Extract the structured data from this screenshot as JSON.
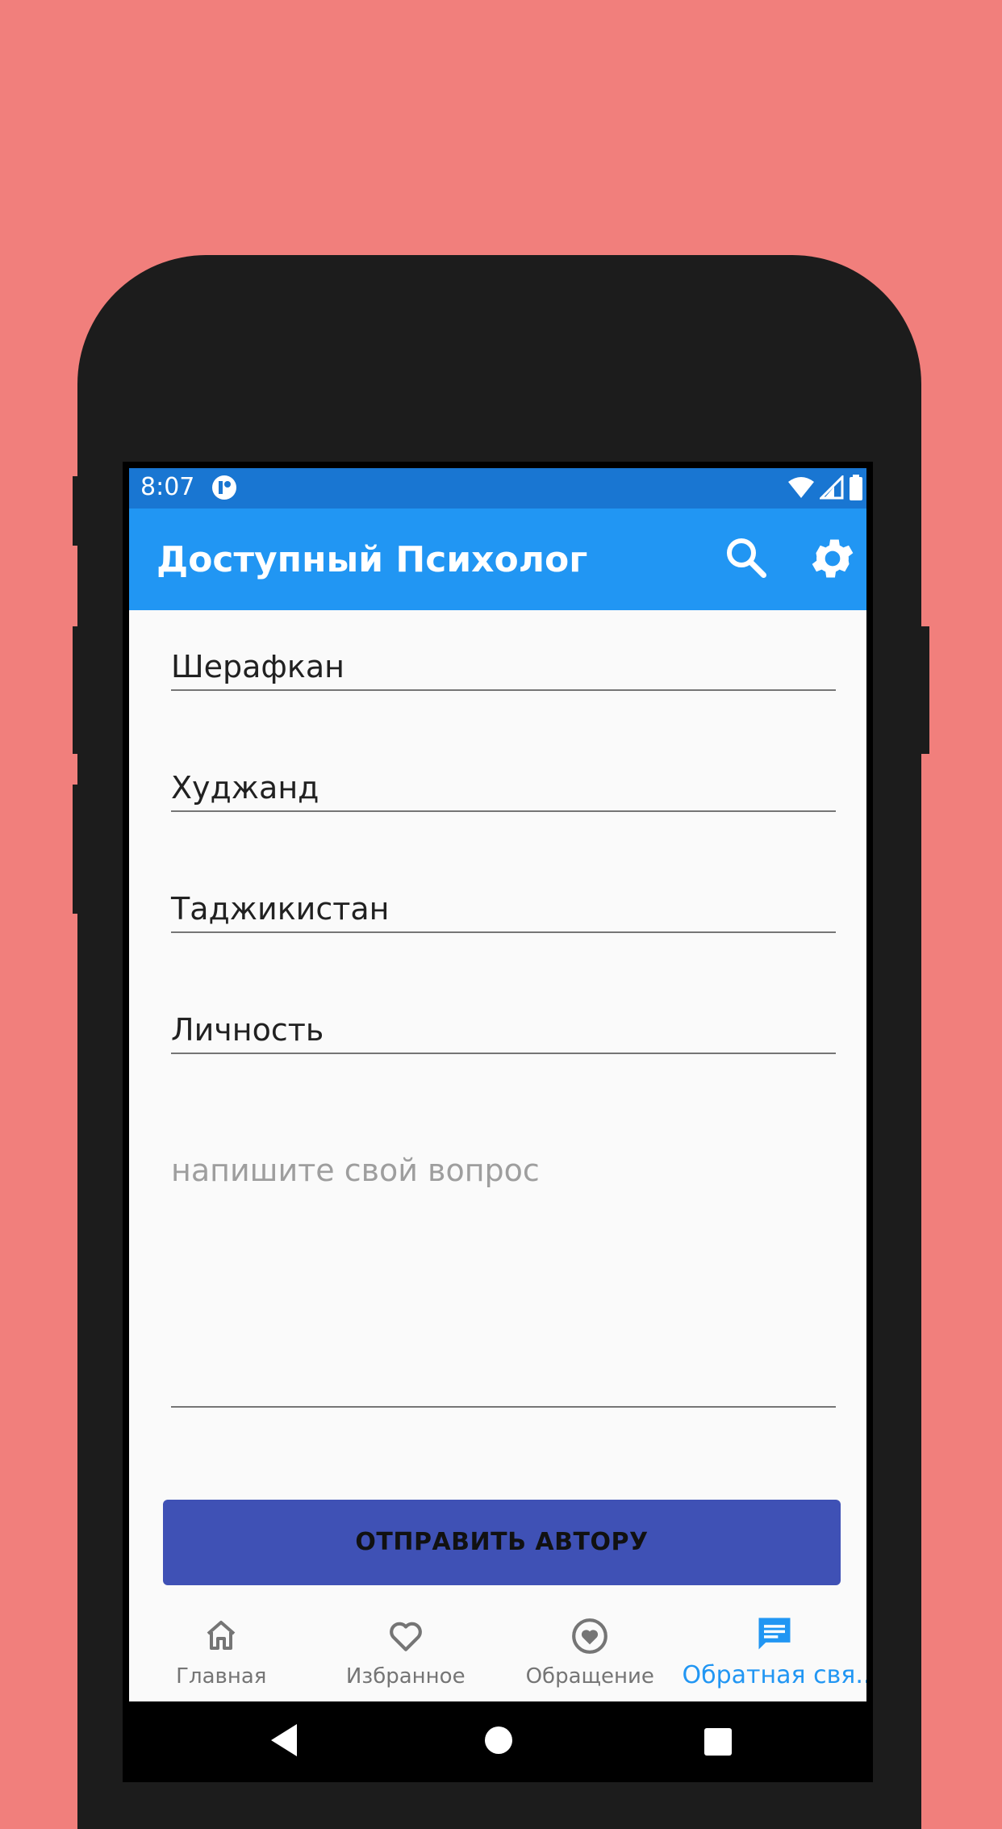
{
  "status": {
    "time": "8:07"
  },
  "appbar": {
    "title": "Доступный Психолог",
    "search_icon": "search-icon",
    "settings_icon": "gear-icon"
  },
  "form": {
    "name_value": "Шерафкан",
    "city_value": "Худжанд",
    "country_value": "Таджикистан",
    "topic_value": "Личность",
    "question_placeholder": "напишите свой вопрос",
    "send_label": "ОТПРАВИТЬ АВТОРУ"
  },
  "bottom_nav": {
    "items": [
      {
        "label": "Главная",
        "icon": "home-icon"
      },
      {
        "label": "Избранное",
        "icon": "heart-outline-icon"
      },
      {
        "label": "Обращение",
        "icon": "heart-circle-icon"
      },
      {
        "label": "Обратная свя...",
        "icon": "message-icon",
        "active": true
      }
    ]
  },
  "colors": {
    "background": "#f17f7c",
    "status_bar": "#1976d2",
    "app_bar": "#2196f3",
    "button": "#3f51b5",
    "active_nav": "#2196f3"
  }
}
